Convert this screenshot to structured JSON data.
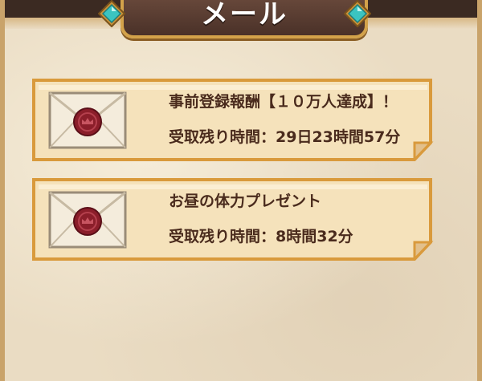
{
  "header": {
    "title": "メール"
  },
  "mail_items": [
    {
      "title": "事前登録報酬【１０万人達成】！",
      "time_label": "受取残り時間：",
      "time_value": "29日23時間57分",
      "icon": "sealed-envelope-icon"
    },
    {
      "title": "お昼の体力プレゼント",
      "time_label": "受取残り時間：",
      "time_value": "8時間32分",
      "icon": "sealed-envelope-icon"
    }
  ],
  "colors": {
    "background": "#eadcc3",
    "card": "#f5e2bb",
    "card_border": "#d99a3c",
    "title_plate": "#4a3128",
    "gem": "#3bc4c0",
    "seal": "#8b1e2a",
    "text": "#4a2b1d"
  }
}
